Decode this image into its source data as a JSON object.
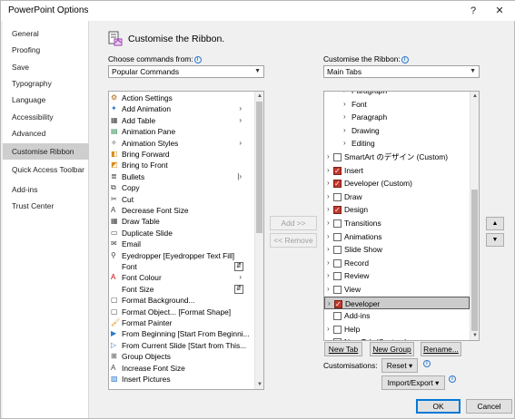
{
  "window": {
    "title": "PowerPoint Options",
    "help_glyph": "?",
    "close_glyph": "✕"
  },
  "sidebar": {
    "items": [
      {
        "label": "General"
      },
      {
        "label": "Proofing"
      },
      {
        "label": "Save"
      },
      {
        "label": "Typography"
      },
      {
        "label": "Language"
      },
      {
        "label": "Accessibility"
      },
      {
        "label": "Advanced"
      },
      {
        "label": "Customise Ribbon",
        "active": true
      },
      {
        "label": "Quick Access Toolbar"
      },
      {
        "label": "Add-ins"
      },
      {
        "label": "Trust Center"
      }
    ]
  },
  "main": {
    "heading": "Customise the Ribbon.",
    "choose_label": "Choose commands from:",
    "choose_value": "Popular Commands",
    "customise_label": "Customise the Ribbon:",
    "customise_value": "Main Tabs",
    "commands": [
      {
        "label": "Action Settings",
        "icon": "action-settings-icon"
      },
      {
        "label": "Add Animation",
        "icon": "add-animation-icon",
        "submenu": true
      },
      {
        "label": "Add Table",
        "icon": "table-icon",
        "submenu": true
      },
      {
        "label": "Animation Pane",
        "icon": "animation-pane-icon"
      },
      {
        "label": "Animation Styles",
        "icon": "animation-styles-icon",
        "submenu": true
      },
      {
        "label": "Bring Forward",
        "icon": "bring-forward-icon"
      },
      {
        "label": "Bring to Front",
        "icon": "bring-to-front-icon"
      },
      {
        "label": "Bullets",
        "icon": "bullets-icon",
        "split": true
      },
      {
        "label": "Copy",
        "icon": "copy-icon"
      },
      {
        "label": "Cut",
        "icon": "cut-icon"
      },
      {
        "label": "Decrease Font Size",
        "icon": "decrease-font-icon"
      },
      {
        "label": "Draw Table",
        "icon": "draw-table-icon"
      },
      {
        "label": "Duplicate Slide",
        "icon": "duplicate-slide-icon"
      },
      {
        "label": "Email",
        "icon": "email-icon"
      },
      {
        "label": "Eyedropper [Eyedropper Text Fill]",
        "icon": "eyedropper-icon"
      },
      {
        "label": "Font",
        "icon": "",
        "boxarrow": true
      },
      {
        "label": "Font Colour",
        "icon": "font-colour-icon",
        "submenu": true
      },
      {
        "label": "Font Size",
        "icon": "",
        "boxarrow": true
      },
      {
        "label": "Format Background...",
        "icon": "format-background-icon"
      },
      {
        "label": "Format Object... [Format Shape]",
        "icon": "format-object-icon"
      },
      {
        "label": "Format Painter",
        "icon": "format-painter-icon"
      },
      {
        "label": "From Beginning [Start From Beginni...",
        "icon": "from-beginning-icon"
      },
      {
        "label": "From Current Slide [Start from This...",
        "icon": "from-current-icon"
      },
      {
        "label": "Group Objects",
        "icon": "group-icon"
      },
      {
        "label": "Increase Font Size",
        "icon": "increase-font-icon"
      },
      {
        "label": "Insert Pictures",
        "icon": "insert-pictures-icon"
      }
    ],
    "tabs_tree": [
      {
        "label": "Paragraph",
        "level": 2,
        "expand": "›",
        "checked": null
      },
      {
        "label": "Font",
        "level": 2,
        "expand": "›",
        "checked": null
      },
      {
        "label": "Paragraph",
        "level": 2,
        "expand": "›",
        "checked": null
      },
      {
        "label": "Drawing",
        "level": 2,
        "expand": "›",
        "checked": null
      },
      {
        "label": "Editing",
        "level": 2,
        "expand": "›",
        "checked": null
      },
      {
        "label": "SmartArt のデザイン (Custom)",
        "level": 1,
        "expand": "›",
        "checked": false
      },
      {
        "label": "Insert",
        "level": 1,
        "expand": "›",
        "checked": true
      },
      {
        "label": "Developer (Custom)",
        "level": 1,
        "expand": "›",
        "checked": true
      },
      {
        "label": "Draw",
        "level": 1,
        "expand": "›",
        "checked": false
      },
      {
        "label": "Design",
        "level": 1,
        "expand": "›",
        "checked": true
      },
      {
        "label": "Transitions",
        "level": 1,
        "expand": "›",
        "checked": false
      },
      {
        "label": "Animations",
        "level": 1,
        "expand": "›",
        "checked": false
      },
      {
        "label": "Slide Show",
        "level": 1,
        "expand": "›",
        "checked": false
      },
      {
        "label": "Record",
        "level": 1,
        "expand": "›",
        "checked": false
      },
      {
        "label": "Review",
        "level": 1,
        "expand": "›",
        "checked": false
      },
      {
        "label": "View",
        "level": 1,
        "expand": "›",
        "checked": false
      },
      {
        "label": "Developer",
        "level": 1,
        "expand": "›",
        "checked": true,
        "selected": true
      },
      {
        "label": "Add-ins",
        "level": 1,
        "expand": "",
        "checked": false
      },
      {
        "label": "Help",
        "level": 1,
        "expand": "›",
        "checked": false
      },
      {
        "label": "New Tab (Custom)",
        "level": 1,
        "expand": "›",
        "checked": false
      }
    ],
    "add_button": "Add >>",
    "remove_button": "<< Remove",
    "new_tab_button": "New Tab",
    "new_group_button": "New Group",
    "rename_button": "Rename...",
    "customisations_label": "Customisations:",
    "reset_button": "Reset ▾",
    "import_export_button": "Import/Export ▾",
    "ok_button": "OK",
    "cancel_button": "Cancel"
  }
}
